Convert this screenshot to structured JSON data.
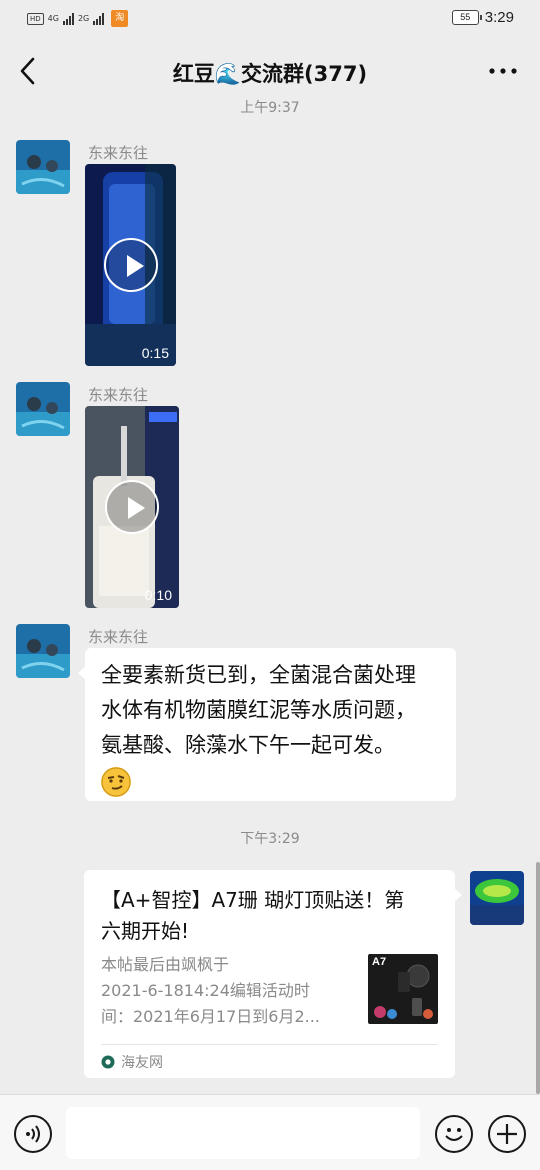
{
  "status_bar": {
    "chip_hd": "HD",
    "net_1": "4G",
    "net_2": "2G",
    "app_icon": "淘",
    "battery": "55",
    "time": "3:29"
  },
  "header": {
    "title": "红豆🌊交流群(377)",
    "back_icon": "chevron-left",
    "more_icon": "more-horizontal"
  },
  "messages": {
    "ts1": "上午9:37",
    "m1": {
      "sender": "东来东往",
      "duration": "0:15"
    },
    "m2": {
      "sender": "东来东往",
      "duration": "0:10"
    },
    "m3": {
      "sender": "东来东往",
      "text_lines": [
        "全要素新货已到，全菌混合菌处理",
        "水体有机物菌膜红泥等水质问题，",
        "氨基酸、除藻水下午一起可发。"
      ],
      "emoji": "smirk-emoji"
    },
    "ts2": "下午3:29",
    "m4": {
      "title_lines": [
        "【A+智控】A7珊 瑚灯顶贴送！第",
        "六期开始!"
      ],
      "desc_lines": [
        "本帖最后由飒枫于",
        "2021-6-1814:24编辑活动时",
        "间：2021年6月17日到6月2..."
      ],
      "thumb_label": "A7",
      "source": "海友网"
    }
  },
  "colors": {
    "background": "#ededed",
    "bubble": "#ffffff",
    "meta_text": "#8a8a8a"
  }
}
